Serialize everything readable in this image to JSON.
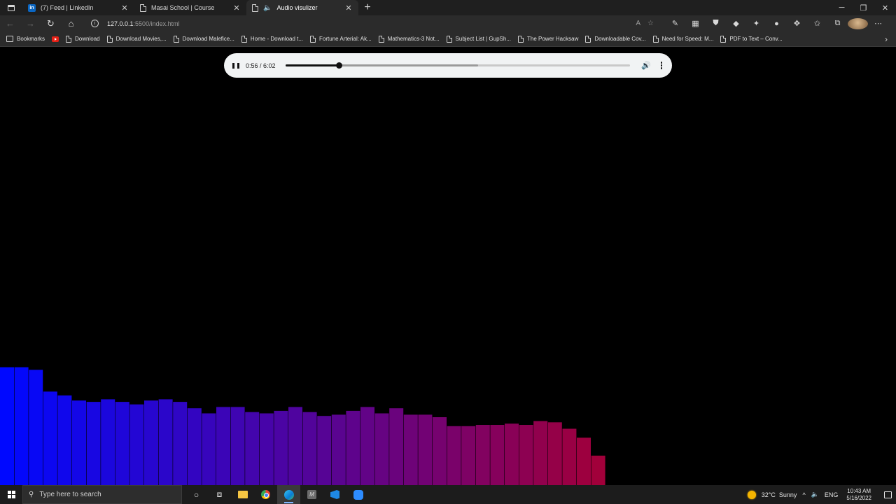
{
  "browser": {
    "tabs": [
      {
        "label": "(7) Feed | LinkedIn",
        "favicon": "linkedin-icon",
        "active": false
      },
      {
        "label": "Masai School | Course",
        "favicon": "page-icon",
        "active": false
      },
      {
        "label": "Audio visulizer",
        "favicon": "page-icon",
        "audio": true,
        "active": true
      }
    ],
    "new_tab": "+",
    "address": {
      "host": "127.0.0.1",
      "rest": ":5500/index.html"
    },
    "bookmarks": [
      {
        "label": "Bookmarks",
        "icon": "folder-icon"
      },
      {
        "label": "",
        "icon": "youtube-icon"
      },
      {
        "label": "Download",
        "icon": "page-icon"
      },
      {
        "label": "Download Movies,...",
        "icon": "page-icon"
      },
      {
        "label": "Download Malefice...",
        "icon": "page-icon"
      },
      {
        "label": "Home - Download t...",
        "icon": "page-icon"
      },
      {
        "label": "Fortune Arterial: Ak...",
        "icon": "page-icon"
      },
      {
        "label": "Mathematics-3 Not...",
        "icon": "page-icon"
      },
      {
        "label": "Subject List | GupSh...",
        "icon": "page-icon"
      },
      {
        "label": "The Power Hacksaw",
        "icon": "page-icon"
      },
      {
        "label": "Downloadable Cov...",
        "icon": "page-icon"
      },
      {
        "label": "Need for Speed: M...",
        "icon": "page-icon"
      },
      {
        "label": "PDF to Text – Conv...",
        "icon": "page-icon"
      }
    ]
  },
  "player": {
    "time_display": "0:56 / 6:02",
    "current_seconds": 56,
    "duration_seconds": 362,
    "buffered_fraction": 0.56,
    "state": "playing"
  },
  "visualizer": {
    "bars": [
      0.92,
      0.92,
      0.9,
      0.73,
      0.7,
      0.66,
      0.65,
      0.67,
      0.65,
      0.63,
      0.66,
      0.67,
      0.65,
      0.6,
      0.56,
      0.61,
      0.61,
      0.57,
      0.56,
      0.58,
      0.61,
      0.57,
      0.54,
      0.55,
      0.58,
      0.61,
      0.56,
      0.6,
      0.55,
      0.55,
      0.53,
      0.46,
      0.46,
      0.47,
      0.47,
      0.48,
      0.47,
      0.5,
      0.49,
      0.44,
      0.37,
      0.23
    ],
    "color_start": "#0008ff",
    "color_end": "#a1003a",
    "background": "#000000"
  },
  "taskbar": {
    "search_placeholder": "Type here to search",
    "weather": "32°C  Sunny",
    "language": "ENG",
    "time": "10:43 AM",
    "date": "5/16/2022"
  }
}
